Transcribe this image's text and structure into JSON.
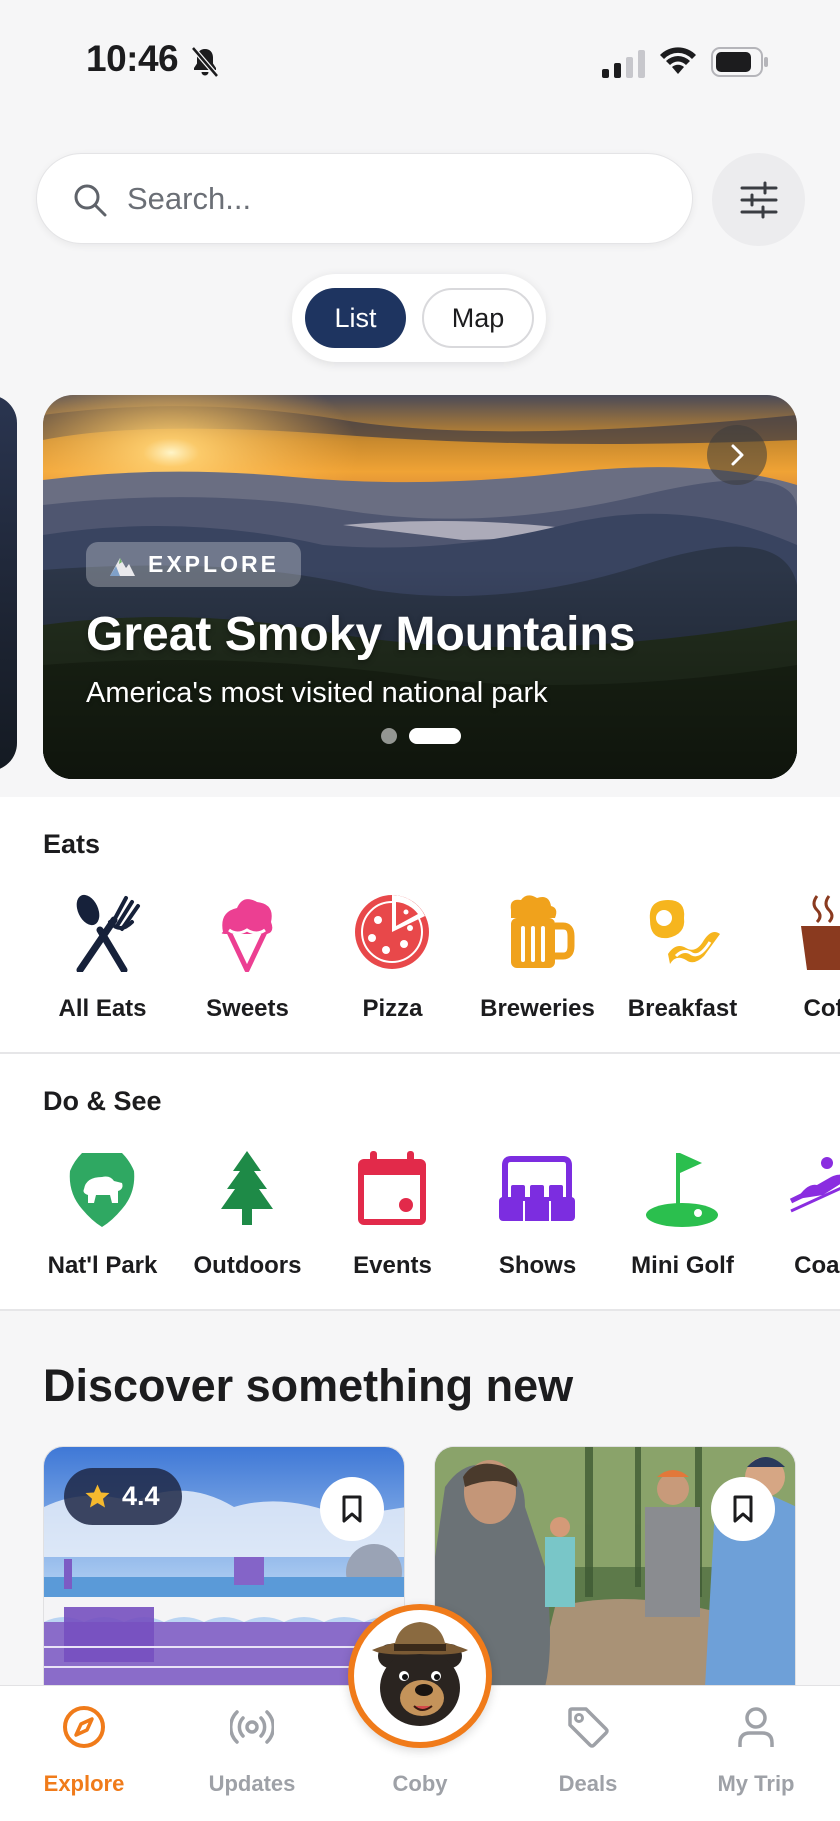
{
  "status_bar": {
    "time": "10:46",
    "icons": [
      "bell-slash-icon",
      "cellular-signal-icon",
      "wifi-icon",
      "battery-icon"
    ]
  },
  "search": {
    "placeholder": "Search...",
    "value": "",
    "icon": "search-icon",
    "filter_icon": "sliders-icon"
  },
  "view_toggle": {
    "options": [
      "List",
      "Map"
    ],
    "selected": "List"
  },
  "hero": {
    "badge": "EXPLORE",
    "title": "Great Smoky Mountains",
    "subtitle": "America's most visited national park",
    "slide_count": 2,
    "active_slide": 2,
    "next_icon": "chevron-right-icon"
  },
  "eats": {
    "title": "Eats",
    "items": [
      {
        "label": "All Eats",
        "icon": "fork-knife-icon"
      },
      {
        "label": "Sweets",
        "icon": "ice-cream-icon"
      },
      {
        "label": "Pizza",
        "icon": "pizza-icon"
      },
      {
        "label": "Breweries",
        "icon": "beer-mug-icon"
      },
      {
        "label": "Breakfast",
        "icon": "egg-bacon-icon"
      },
      {
        "label": "Coff",
        "icon": "coffee-cup-icon"
      }
    ]
  },
  "do_see": {
    "title": "Do & See",
    "items": [
      {
        "label": "Nat'l Park",
        "icon": "park-shield-icon"
      },
      {
        "label": "Outdoors",
        "icon": "pine-tree-icon"
      },
      {
        "label": "Events",
        "icon": "calendar-icon"
      },
      {
        "label": "Shows",
        "icon": "theater-seats-icon"
      },
      {
        "label": "Mini Golf",
        "icon": "golf-flag-icon"
      },
      {
        "label": "Coast",
        "icon": "coaster-icon"
      }
    ]
  },
  "discover": {
    "title": "Discover something new",
    "cards": [
      {
        "rating": "4.4",
        "bookmark_icon": "bookmark-icon"
      },
      {
        "bookmark_icon": "bookmark-icon"
      }
    ]
  },
  "tab_bar": {
    "tabs": [
      {
        "label": "Explore",
        "icon": "compass-icon",
        "active": true
      },
      {
        "label": "Updates",
        "icon": "broadcast-icon",
        "active": false
      },
      {
        "label": "Coby",
        "icon": "bear-mascot-icon",
        "active": false
      },
      {
        "label": "Deals",
        "icon": "price-tag-icon",
        "active": false
      },
      {
        "label": "My Trip",
        "icon": "person-icon",
        "active": false
      }
    ]
  },
  "colors": {
    "accent_orange": "#f07b1a",
    "navy": "#1e3460",
    "inactive_tab": "#9ea1a7"
  }
}
